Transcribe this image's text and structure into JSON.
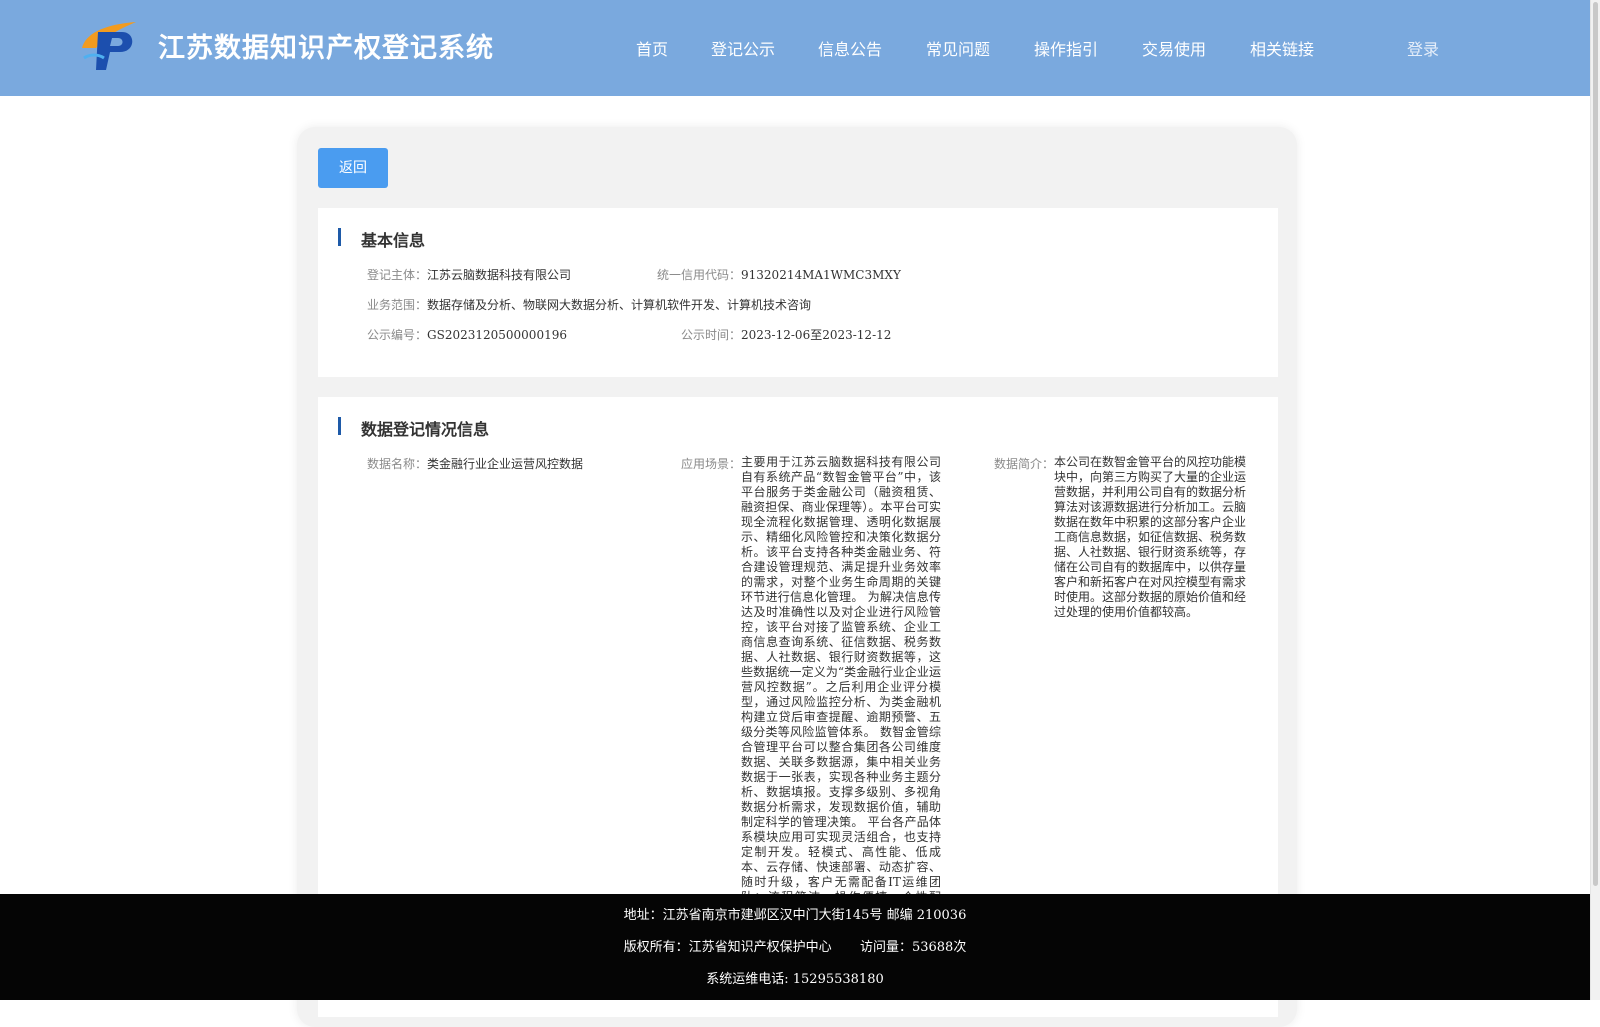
{
  "header": {
    "title": "江苏数据知识产权登记系统",
    "nav": [
      "首页",
      "登记公示",
      "信息公告",
      "常见问题",
      "操作指引",
      "交易使用",
      "相关链接"
    ],
    "login": "登录",
    "colors": {
      "header_bg": "#7aa9de",
      "accent": "#4a9cf0"
    }
  },
  "actions": {
    "back_label": "返回"
  },
  "basic_info": {
    "title": "基本信息",
    "subject_label": "登记主体：",
    "subject_value": "江苏云脑数据科技有限公司",
    "credit_label": "统一信用代码：",
    "credit_value": "91320214MA1WMC3MXY",
    "scope_label": "业务范围：",
    "scope_value": "数据存储及分析、物联网大数据分析、计算机软件开发、计算机技术咨询",
    "notice_no_label": "公示编号：",
    "notice_no_value": "GS2023120500000196",
    "notice_time_label": "公示时间：",
    "notice_time_value": "2023-12-06至2023-12-12"
  },
  "data_registration": {
    "title": "数据登记情况信息",
    "name_label": "数据名称：",
    "name_value": "类金融行业企业运营风控数据",
    "scene_label": "应用场景：",
    "scene_value": "主要用于江苏云脑数据科技有限公司自有系统产品“数智金管平台”中，该平台服务于类金融公司（融资租赁、融资担保、商业保理等）。本平台可实现全流程化数据管理、透明化数据展示、精细化风险管控和决策化数据分析。该平台支持各种类金融业务、符合建设管理规范、满足提升业务效率的需求，对整个业务生命周期的关键环节进行信息化管理。 为解决信息传达及时准确性以及对企业进行风险管控，该平台对接了监管系统、企业工商信息查询系统、征信数据、税务数据、人社数据、银行财资数据等，这些数据统一定义为“类金融行业企业运营风控数据”。之后利用企业评分模型，通过风险监控分析、为类金融机构建立贷后审查提醒、逾期预警、五级分类等风险监管体系。 数智金管综合管理平台可以整合集团各公司维度数据、关联多数据源，集中相关业务数据于一张表，实现各种业务主题分析、数据填报。支撑多级别、多视角数据分析需求，发现数据价值，辅助制定科学的管理决策。 平台各产品体系模块应用可实现灵活组合，也支持定制开发。轻模式、高性能、低成本、云存储、快速部署、动态扩容、随时升级，客户无需配备IT运维团队；流程简洁，操作便捷，个性配置，灵活方便。",
    "intro_label": "数据简介：",
    "intro_value": "本公司在数智金管平台的风控功能模块中，向第三方购买了大量的企业运营数据，并利用公司自有的数据分析算法对该源数据进行分析加工。云脑数据在数年中积累的这部分客户企业工商信息数据，如征信数据、税务数据、人社数据、银行财资系统等，存储在公司自有的数据库中，以供存量客户和新拓客户在对风控模型有需求时使用。这部分数据的原始价值和经过处理的使用价值都较高。"
  },
  "footer": {
    "address": "地址：江苏省南京市建邺区汉中门大街145号 邮编 210036",
    "copyright": "版权所有：江苏省知识产权保护中心",
    "visits": "访问量：53688次",
    "phone": "系统运维电话: 15295538180"
  }
}
